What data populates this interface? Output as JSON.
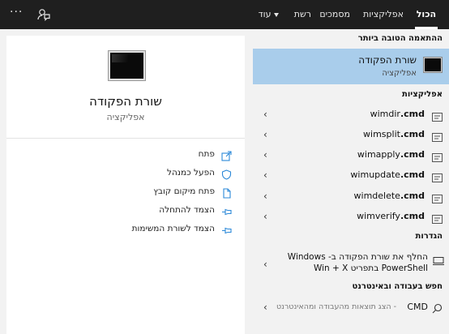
{
  "topbar": {
    "tabs": [
      {
        "label": "הכול"
      },
      {
        "label": "אפליקציות"
      },
      {
        "label": "מסמכים"
      },
      {
        "label": "רשת"
      },
      {
        "label": "עוד"
      }
    ],
    "icons": {
      "feedback": "feedback-icon",
      "more": "ellipsis-icon"
    },
    "more_glyph": "···"
  },
  "detail": {
    "title": "שורת הפקודה",
    "subtitle": "אפליקציה",
    "actions": [
      {
        "label": "פתח",
        "icon": "open-icon"
      },
      {
        "label": "הפעל כמנהל",
        "icon": "shield-icon"
      },
      {
        "label": "פתח מיקום קובץ",
        "icon": "file-location-icon"
      },
      {
        "label": "הצמד להתחלה",
        "icon": "pin-icon"
      },
      {
        "label": "הצמד לשורת המשימות",
        "icon": "pin-icon"
      }
    ]
  },
  "results": {
    "best_match": {
      "heading": "ההתאמה הטובה ביותר",
      "title": "שורת הפקודה",
      "subtitle": "אפליקציה",
      "icon": "terminal-icon"
    },
    "apps_heading": "אפליקציות",
    "apps": [
      {
        "name": "wimdir",
        "ext": ".cmd"
      },
      {
        "name": "wimsplit",
        "ext": ".cmd"
      },
      {
        "name": "wimapply",
        "ext": ".cmd"
      },
      {
        "name": "wimupdate",
        "ext": ".cmd"
      },
      {
        "name": "wimdelete",
        "ext": ".cmd"
      },
      {
        "name": "wimverify",
        "ext": ".cmd"
      }
    ],
    "settings_heading": "הגדרות",
    "setting": {
      "text": "החלף את שורת הפקודה ב- Windows PowerShell בתפריט Win + X",
      "icon": "monitor-icon"
    },
    "web_heading": "חפש בעבודה ובאינטרנט",
    "web": {
      "label": "CMD",
      "hint": "הצג תוצאות מהעבודה ומהאינטרנט -",
      "icon": "search-icon"
    },
    "chevron_glyph": "‹"
  },
  "colors": {
    "topbar": "#1f1f1f",
    "selected": "#a9cdeb",
    "accent": "#2b88d8"
  }
}
